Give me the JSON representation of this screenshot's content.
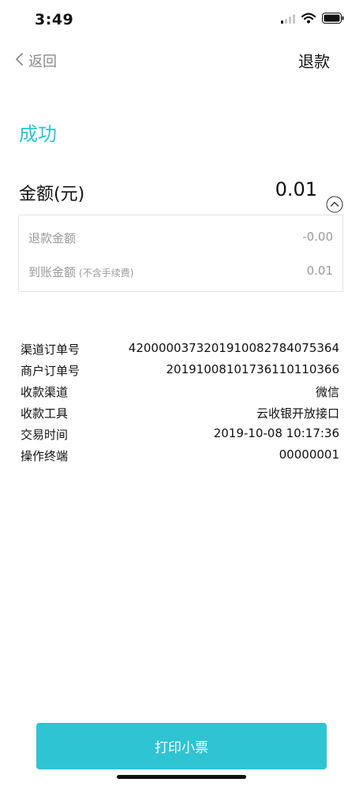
{
  "status_bar": {
    "time": "3:49",
    "icons": [
      "signal-icon",
      "wifi-icon",
      "battery-icon"
    ]
  },
  "nav": {
    "back_label": "返回",
    "action_label": "退款"
  },
  "result": {
    "status": "成功"
  },
  "amount": {
    "label": "金额(元)",
    "value": "0.01"
  },
  "details": [
    {
      "label": "退款金额",
      "note": "",
      "value": "-0.00"
    },
    {
      "label": "到账金额",
      "note": "(不含手续费)",
      "value": "0.01"
    }
  ],
  "info": [
    {
      "label": "渠道订单号",
      "value": "4200000373201910082784075364"
    },
    {
      "label": "商户订单号",
      "value": "20191008101736110110366"
    },
    {
      "label": "收款渠道",
      "value": "微信"
    },
    {
      "label": "收款工具",
      "value": "云收银开放接口"
    },
    {
      "label": "交易时间",
      "value": "2019-10-08 10:17:36"
    },
    {
      "label": "操作终端",
      "value": "00000001"
    }
  ],
  "print_button_label": "打印小票",
  "colors": {
    "accent": "#2ec4d4",
    "text": "#111111",
    "muted": "#9a9a9a",
    "border": "#e2e2e2"
  }
}
